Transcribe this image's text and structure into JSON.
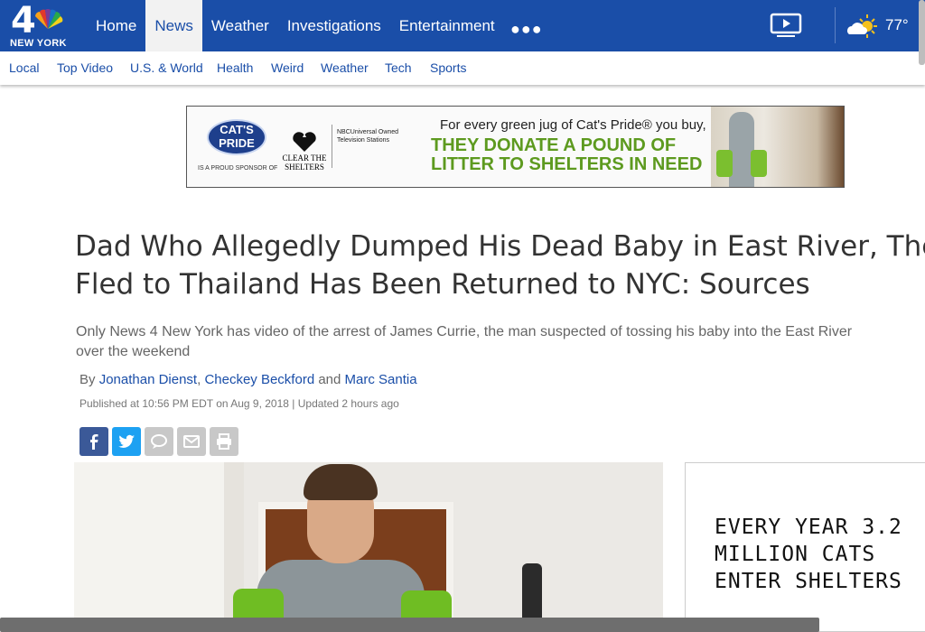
{
  "logo": {
    "number": "4",
    "station": "NEW YORK"
  },
  "nav": {
    "items": [
      {
        "label": "Home"
      },
      {
        "label": "News",
        "active": true
      },
      {
        "label": "Weather"
      },
      {
        "label": "Investigations"
      },
      {
        "label": "Entertainment"
      }
    ],
    "more_icon": "more-dots-icon",
    "video_icon": "video-play-icon",
    "weather": {
      "icon": "partly-cloudy-icon",
      "temperature": "77°"
    }
  },
  "subnav": {
    "items": [
      {
        "label": "Local"
      },
      {
        "label": "Top Video"
      },
      {
        "label": "U.S. & World"
      },
      {
        "label": "Health"
      },
      {
        "label": "Weird"
      },
      {
        "label": "Weather"
      },
      {
        "label": "Tech"
      },
      {
        "label": "Sports"
      }
    ]
  },
  "ad_banner": {
    "brand": "CAT'S PRIDE",
    "sponsor_text": "IS A PROUD SPONSOR OF",
    "partner": "CLEAR THE SHELTERS",
    "network": "NBCUniversal Owned Television Stations",
    "line1": "For every green jug of Cat's Pride® you buy,",
    "line2": "THEY DONATE A POUND OF",
    "line3": "LITTER TO SHELTERS IN NEED"
  },
  "article": {
    "headline_lines": [
      "Dad Who Allegedly Dumped His Dead Baby in East River, Then",
      "Fled to Thailand Has Been Returned to NYC: Sources"
    ],
    "dek_lines": [
      "Only News 4 New York has video of the arrest of James Currie, the man suspected of tossing his baby into the East River",
      "over the weekend"
    ],
    "byline": {
      "prefix": "By",
      "authors": [
        "Jonathan Dienst",
        "Checkey Beckford",
        "Marc Santia"
      ],
      "sep1": ",",
      "sep2": "and"
    },
    "published": "Published at 10:56 PM EDT on Aug 9, 2018 | Updated 2 hours ago"
  },
  "share": {
    "buttons": [
      {
        "icon": "facebook-icon",
        "color": "#3b5998"
      },
      {
        "icon": "twitter-icon",
        "color": "#1da1f2"
      },
      {
        "icon": "comment-icon",
        "color": "#c8c8c8"
      },
      {
        "icon": "email-icon",
        "color": "#c8c8c8"
      },
      {
        "icon": "print-icon",
        "color": "#c8c8c8"
      }
    ]
  },
  "side_ad": {
    "lines": [
      "EVERY YEAR 3.2",
      "MILLION CATS",
      "ENTER SHELTERS"
    ]
  },
  "colors": {
    "brand_blue": "#1a4ea8",
    "ad_green": "#5d9a1f"
  }
}
